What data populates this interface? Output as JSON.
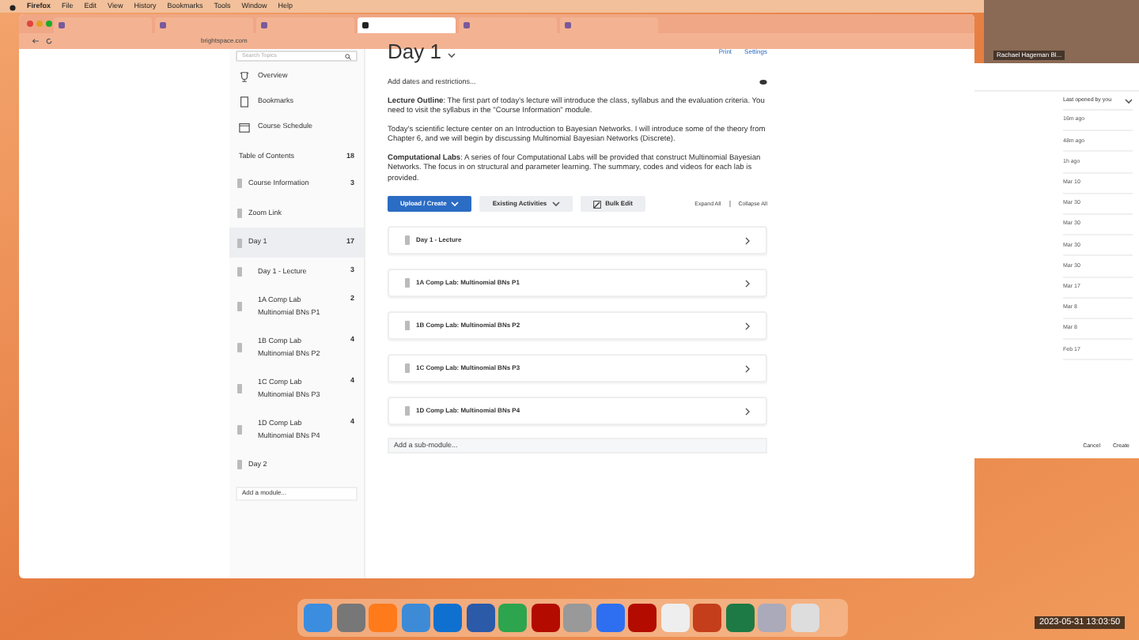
{
  "menu_bar": {
    "app": "Firefox",
    "items": [
      "File",
      "Edit",
      "View",
      "History",
      "Bookmarks",
      "Tools",
      "Window",
      "Help"
    ]
  },
  "browser": {
    "tabs": [
      {
        "selected": false
      },
      {
        "selected": false
      },
      {
        "selected": false
      },
      {
        "selected": true
      },
      {
        "selected": false
      },
      {
        "selected": false
      }
    ],
    "url_host": "brightspace.com"
  },
  "sidebar": {
    "search": {
      "placeholder": "Search Topics"
    },
    "nav": [
      {
        "kind": "overview",
        "label": "Overview"
      },
      {
        "kind": "bookmark",
        "label": "Bookmarks"
      },
      {
        "kind": "calendar",
        "label": "Course Schedule"
      }
    ],
    "toc": {
      "label": "Table of Contents",
      "count": "18"
    },
    "modules": [
      {
        "label": "Course Information",
        "count": "3",
        "selected": false
      },
      {
        "label": "Zoom Link",
        "selected": false
      },
      {
        "label": "Day 1",
        "count": "17",
        "selected": true,
        "children": [
          {
            "label": "Day 1 - Lecture",
            "count": "3"
          },
          {
            "label": "1A Comp Lab Multinomial BNs P1",
            "count": "2"
          },
          {
            "label": "1B Comp Lab Multinomial BNs P2",
            "count": "4"
          },
          {
            "label": "1C Comp Lab Multinomial BNs P3",
            "count": "4"
          },
          {
            "label": "1D Comp Lab Multinomial BNs P4",
            "count": "4"
          }
        ]
      },
      {
        "label": "Day 2",
        "selected": false
      }
    ],
    "add_module": "Add a module..."
  },
  "content": {
    "title": "Day 1",
    "print": "Print",
    "settings": "Settings",
    "restrictions": "Add dates and restrictions...",
    "paragraphs": [
      "**Lecture Outline**: The first part of today's lecture will introduce the class, syllabus and the evaluation criteria.  You need to visit the syllabus in the \"Course Information\" module.",
      "Today's scientific lecture center on an Introduction to Bayesian Networks.  I will introduce some of the theory from Chapter 6, and we will begin by discussing Multinomial Bayesian Networks (Discrete).",
      "**Computational Labs**: A series of four Computational Labs will be provided that construct Multinomial Bayesian Networks.  The focus in on structural and parameter learning.  The summary, codes and videos for each lab is provided."
    ],
    "buttons": [
      {
        "kind": "primary",
        "label": "Upload / Create"
      },
      {
        "kind": "dropdown",
        "label": "Existing Activities"
      },
      {
        "kind": "edit",
        "label": "Bulk Edit"
      }
    ],
    "expand_all": "Expand All",
    "collapse_all": "Collapse All",
    "submodules": [
      "Day 1 - Lecture",
      "1A Comp Lab: Multinomial BNs P1",
      "1B Comp Lab: Multinomial BNs P2",
      "1C Comp Lab: Multinomial BNs P3",
      "1D Comp Lab: Multinomial BNs P4"
    ],
    "add_submodule": "Add a sub-module..."
  },
  "video": {
    "name": "Rachael Hageman Bl..."
  },
  "side_window": {
    "sort": "Last opened by you",
    "dates": [
      "16m ago",
      "48m ago",
      "1h ago",
      "Mar 10",
      "Mar 30",
      "Mar 30",
      "Mar 30",
      "Mar 30",
      "Mar 17",
      "Mar 8",
      "Mar 8",
      "Feb 17"
    ],
    "cancel": "Cancel",
    "create": "Create"
  },
  "dock": {
    "apps": [
      {
        "kind": "finder"
      },
      {
        "kind": "settings"
      },
      {
        "kind": "firefox"
      },
      {
        "kind": "xcode"
      },
      {
        "kind": "outlook"
      },
      {
        "kind": "word"
      },
      {
        "kind": "chrome"
      },
      {
        "kind": "acrobat"
      },
      {
        "kind": "tex"
      },
      {
        "kind": "zoom"
      },
      {
        "kind": "acrobat"
      },
      {
        "kind": "textedit"
      },
      {
        "kind": "powerpoint"
      },
      {
        "kind": "excel"
      },
      {
        "kind": "r"
      },
      {
        "kind": "trash"
      }
    ]
  },
  "timestamp": "2023-05-31 13:03:50"
}
